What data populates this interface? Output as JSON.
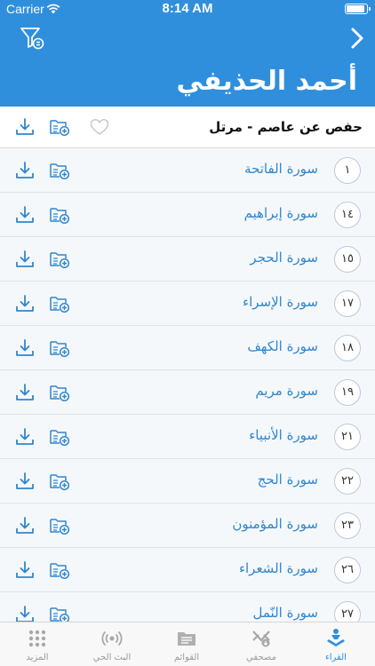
{
  "status_bar": {
    "carrier": "Carrier",
    "time": "8:14 AM",
    "battery_level": 0.9
  },
  "header": {
    "title": "أحمد الحذيفي"
  },
  "riwaya": {
    "label": "حفص عن عاصم - مرتل"
  },
  "suras": [
    {
      "number": "١",
      "name": "سورة الفاتحة"
    },
    {
      "number": "١٤",
      "name": "سورة إبراهيم"
    },
    {
      "number": "١٥",
      "name": "سورة الحجر"
    },
    {
      "number": "١٧",
      "name": "سورة الإسراء"
    },
    {
      "number": "١٨",
      "name": "سورة الكهف"
    },
    {
      "number": "١٩",
      "name": "سورة مريم"
    },
    {
      "number": "٢١",
      "name": "سورة الأنبياء"
    },
    {
      "number": "٢٢",
      "name": "سورة الحج"
    },
    {
      "number": "٢٣",
      "name": "سورة المؤمنون"
    },
    {
      "number": "٢٦",
      "name": "سورة الشعراء"
    },
    {
      "number": "٢٧",
      "name": "سورة النّمل"
    }
  ],
  "tabs": [
    {
      "label": "المزيد",
      "icon": "grid-dots-icon",
      "active": false
    },
    {
      "label": "البث الحي",
      "icon": "broadcast-icon",
      "active": false
    },
    {
      "label": "القوائم",
      "icon": "playlist-folder-icon",
      "active": false
    },
    {
      "label": "مصحفي",
      "icon": "mushaf-icon",
      "active": false
    },
    {
      "label": "القراء",
      "icon": "reader-icon",
      "active": true
    }
  ],
  "colors": {
    "brand": "#2f8fdc",
    "sura_text": "#2f86cf",
    "list_bg": "#f5f8fb"
  }
}
